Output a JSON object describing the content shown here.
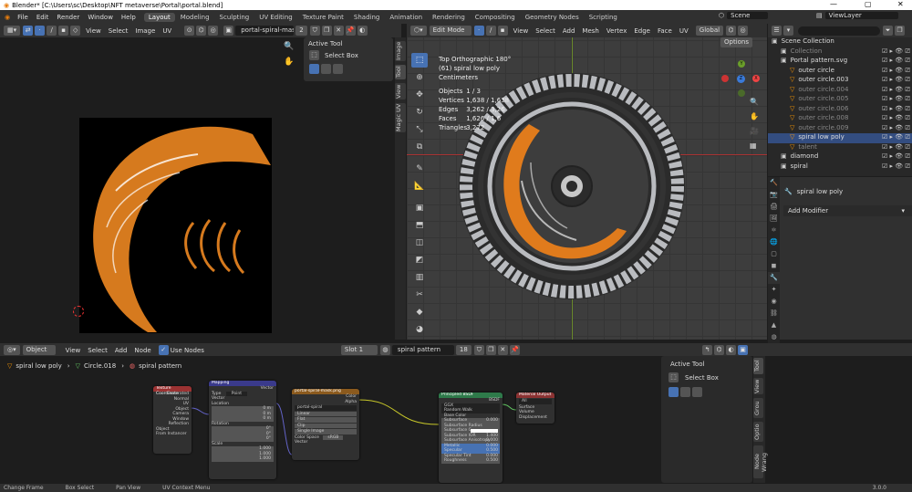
{
  "title": "Blender* [C:\\Users\\sc\\Desktop\\NFT metaverse\\Portal\\portal.blend]",
  "menu": [
    "File",
    "Edit",
    "Render",
    "Window",
    "Help"
  ],
  "workspaces": [
    "Layout",
    "Modeling",
    "Sculpting",
    "UV Editing",
    "Texture Paint",
    "Shading",
    "Animation",
    "Rendering",
    "Compositing",
    "Geometry Nodes",
    "Scripting"
  ],
  "scene_label": "Scene",
  "viewlayer_label": "ViewLayer",
  "uv": {
    "header_items": [
      "View",
      "Select",
      "Image",
      "UV"
    ],
    "image_name": "portal-spiral-mask.png",
    "image_users": "2",
    "active_tool_title": "Active Tool",
    "select_box": "Select Box",
    "tabs": [
      "Image",
      "Tool",
      "View",
      "Magic UV"
    ]
  },
  "viewport": {
    "mode": "Edit Mode",
    "header_items": [
      "View",
      "Select",
      "Add",
      "Mesh",
      "Vertex",
      "Edge",
      "Face",
      "UV"
    ],
    "orientation": "Global",
    "options": "Options",
    "view_name": "Top Orthographic 180°",
    "object_line": "(61) spiral low poly",
    "units": "Centimeters",
    "stats": [
      {
        "label": "Objects",
        "value": "1 / 3"
      },
      {
        "label": "Vertices",
        "value": "1,638 / 1,638"
      },
      {
        "label": "Edges",
        "value": "3,262 / 3,26"
      },
      {
        "label": "Faces",
        "value": "1,626 / 1,6"
      },
      {
        "label": "Triangles",
        "value": "3,272"
      }
    ],
    "gizmo": {
      "x": "X",
      "y": "Y",
      "z": "Z"
    }
  },
  "outliner": {
    "items": [
      {
        "label": "Scene Collection",
        "indent": 0,
        "dim": false,
        "sel": false
      },
      {
        "label": "Collection",
        "indent": 1,
        "dim": true,
        "sel": false
      },
      {
        "label": "Portal pattern.svg",
        "indent": 1,
        "dim": false,
        "sel": false
      },
      {
        "label": "outer circle",
        "indent": 2,
        "dim": false,
        "sel": false
      },
      {
        "label": "outer circle.003",
        "indent": 2,
        "dim": false,
        "sel": false
      },
      {
        "label": "outer circle.004",
        "indent": 2,
        "dim": true,
        "sel": false
      },
      {
        "label": "outer circle.005",
        "indent": 2,
        "dim": true,
        "sel": false
      },
      {
        "label": "outer circle.006",
        "indent": 2,
        "dim": true,
        "sel": false
      },
      {
        "label": "outer circle.008",
        "indent": 2,
        "dim": true,
        "sel": false
      },
      {
        "label": "outer circle.009",
        "indent": 2,
        "dim": true,
        "sel": false
      },
      {
        "label": "spiral low poly",
        "indent": 2,
        "dim": false,
        "sel": true
      },
      {
        "label": "talent",
        "indent": 2,
        "dim": true,
        "sel": false
      },
      {
        "label": "diamond",
        "indent": 1,
        "dim": false,
        "sel": false
      },
      {
        "label": "spiral",
        "indent": 1,
        "dim": false,
        "sel": false
      }
    ]
  },
  "properties": {
    "object_name": "spiral low poly",
    "add_modifier": "Add Modifier"
  },
  "nodeeditor": {
    "object_mode": "Object",
    "header_items": [
      "View",
      "Select",
      "Add",
      "Node"
    ],
    "use_nodes": "Use Nodes",
    "slot": "Slot 1",
    "material": "spiral pattern",
    "material_users": "18",
    "breadcrumb": [
      "spiral low poly",
      "Circle.018",
      "spiral pattern"
    ],
    "active_tool_title": "Active Tool",
    "select_box": "Select Box",
    "side_tabs": [
      "Tool",
      "View",
      "Grou",
      "Optio",
      "Node Wrang"
    ],
    "nodes": {
      "texcoord": {
        "title": "Texture Coordinate",
        "outputs": [
          "Generated",
          "Normal",
          "UV",
          "Object",
          "Camera",
          "Window",
          "Reflection"
        ],
        "object": "Object",
        "from_instancer": "From Instancer"
      },
      "mapping": {
        "title": "Mapping",
        "out": "Vector",
        "type_label": "Type",
        "type": "Point",
        "vector": "Vector",
        "location": "Location",
        "rotation": "Rotation",
        "scale": "Scale",
        "loc": [
          "0 m",
          "0 m",
          "0 m"
        ],
        "rot": [
          "0°",
          "0°",
          "0°"
        ],
        "scl": [
          "1.000",
          "1.000",
          "1.000"
        ]
      },
      "image": {
        "title": "portal-spiral-mask.png",
        "color": "Color",
        "alpha": "Alpha",
        "img": "portal-spiral",
        "opts": [
          "Linear",
          "Flat",
          "Clip",
          "Single Image"
        ],
        "cs_label": "Color Space",
        "cs": "sRGB",
        "vector": "Vector"
      },
      "bsdf": {
        "title": "Principled BSDF",
        "out": "BSDF",
        "rows": [
          "GGX",
          "Random Walk",
          "Base Color",
          "Subsurface",
          "Subsurface Radius",
          "Subsurface C...",
          "Subsurface IOR",
          "Subsurface Anisotropy",
          "Metallic",
          "Specular",
          "Specular Tint",
          "Roughness"
        ],
        "vals": [
          "",
          "",
          "",
          "0.000",
          "",
          "",
          "1.400",
          "0.000",
          "0.000",
          "0.500",
          "0.000",
          "0.500"
        ]
      },
      "output": {
        "title": "Material Output",
        "target": "All",
        "rows": [
          "Surface",
          "Volume",
          "Displacement"
        ]
      }
    }
  },
  "status": [
    "Change Frame",
    "Box Select",
    "Pan View",
    "UV Context Menu"
  ],
  "version": "3.0.0",
  "colors": {
    "accent": "#4772b3",
    "orange": "#e07b1c",
    "selected_row": "#334d80"
  }
}
